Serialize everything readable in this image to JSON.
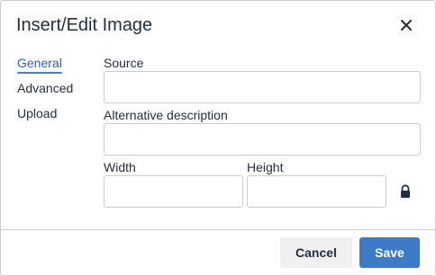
{
  "dialog": {
    "title": "Insert/Edit Image",
    "close_icon": "close-icon"
  },
  "tabs": [
    {
      "label": "General",
      "active": true
    },
    {
      "label": "Advanced",
      "active": false
    },
    {
      "label": "Upload",
      "active": false
    }
  ],
  "fields": {
    "source": {
      "label": "Source",
      "value": ""
    },
    "alt": {
      "label": "Alternative description",
      "value": ""
    },
    "width": {
      "label": "Width",
      "value": ""
    },
    "height": {
      "label": "Height",
      "value": ""
    },
    "lock_icon": "lock-icon"
  },
  "footer": {
    "cancel_label": "Cancel",
    "save_label": "Save"
  },
  "colors": {
    "accent": "#3d7bc6",
    "active_tab_text": "#335dab",
    "border": "#cccccc"
  }
}
